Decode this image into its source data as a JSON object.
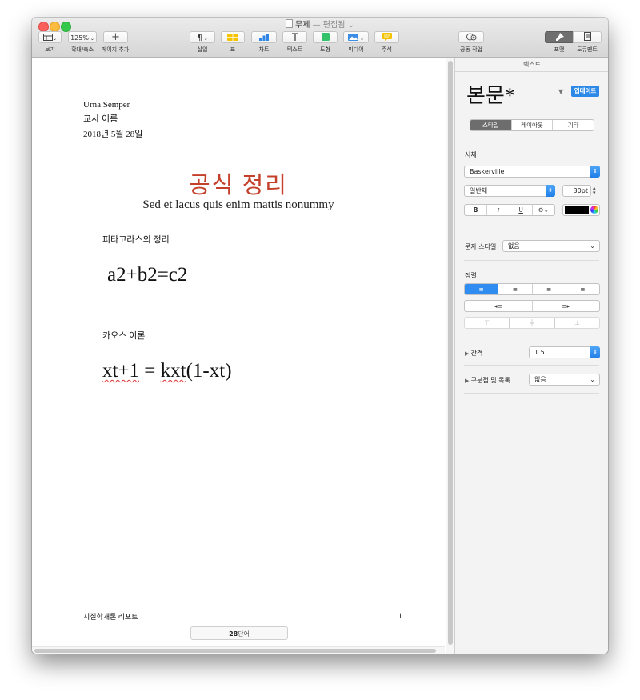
{
  "window": {
    "title": "무제",
    "edited": "— 편집됨",
    "title_chevron": "⌄"
  },
  "toolbar": {
    "view": {
      "label": "보기",
      "icon": "sidebar-icon"
    },
    "zoom": {
      "value": "125%",
      "label": "확대/축소"
    },
    "add_page": {
      "label": "페이지 추가",
      "icon": "plus-icon"
    },
    "insert": {
      "label": "삽입",
      "icon": "paragraph-icon"
    },
    "table": {
      "label": "표",
      "icon": "table-icon",
      "color": "#f5c400"
    },
    "chart": {
      "label": "차트",
      "icon": "bar-chart-icon",
      "color": "#2f86e6"
    },
    "text": {
      "label": "텍스트",
      "icon": "text-t-icon"
    },
    "shape": {
      "label": "도형",
      "icon": "shape-icon",
      "color": "#32c26a"
    },
    "media": {
      "label": "미디어",
      "icon": "image-icon",
      "color": "#3b8de6"
    },
    "comment": {
      "label": "주석",
      "icon": "comment-icon",
      "color": "#f5c400"
    },
    "collaborate": {
      "label": "공동 작업",
      "icon": "collaborate-icon"
    },
    "format": {
      "label": "포맷",
      "icon": "paintbrush-icon"
    },
    "document": {
      "label": "도큐멘트",
      "icon": "document-icon"
    }
  },
  "document": {
    "author": "Urna Semper",
    "teacher": "교사 이름",
    "date": "2018년 5월 28일",
    "title": "공식 정리",
    "title_color": "#c4402a",
    "subtitle": "Sed et lacus quis enim mattis nonummy",
    "section1_heading": "피타고라스의 정리",
    "formula1": "a2+b2=c2",
    "section2_heading": "카오스 이론",
    "formula2_prefix": "xt+1",
    "formula2_eq": "=",
    "formula2_term": "kxt",
    "formula2_rest": "(1-xt)",
    "footer_left": "지질학개론 리포트",
    "footer_page": "1",
    "word_count": "28",
    "word_count_unit": "단어"
  },
  "inspector": {
    "header": "텍스트",
    "style_name": "본문*",
    "update_button": "업데이트",
    "tabs": [
      "스타일",
      "레이아웃",
      "기타"
    ],
    "font_section": "서체",
    "font_family": "Baskerville",
    "font_weight": "일반체",
    "font_size": "30pt",
    "bold": "B",
    "italic": "I",
    "underline": "U",
    "gear_menu": "⚙⌄",
    "text_color": "#000000",
    "char_style_label": "문자 스타일",
    "char_style_value": "없음",
    "alignment_section": "정렬",
    "spacing_label": "간격",
    "spacing_value": "1.5",
    "bullets_label": "구분점 및 목록",
    "bullets_value": "없음"
  }
}
